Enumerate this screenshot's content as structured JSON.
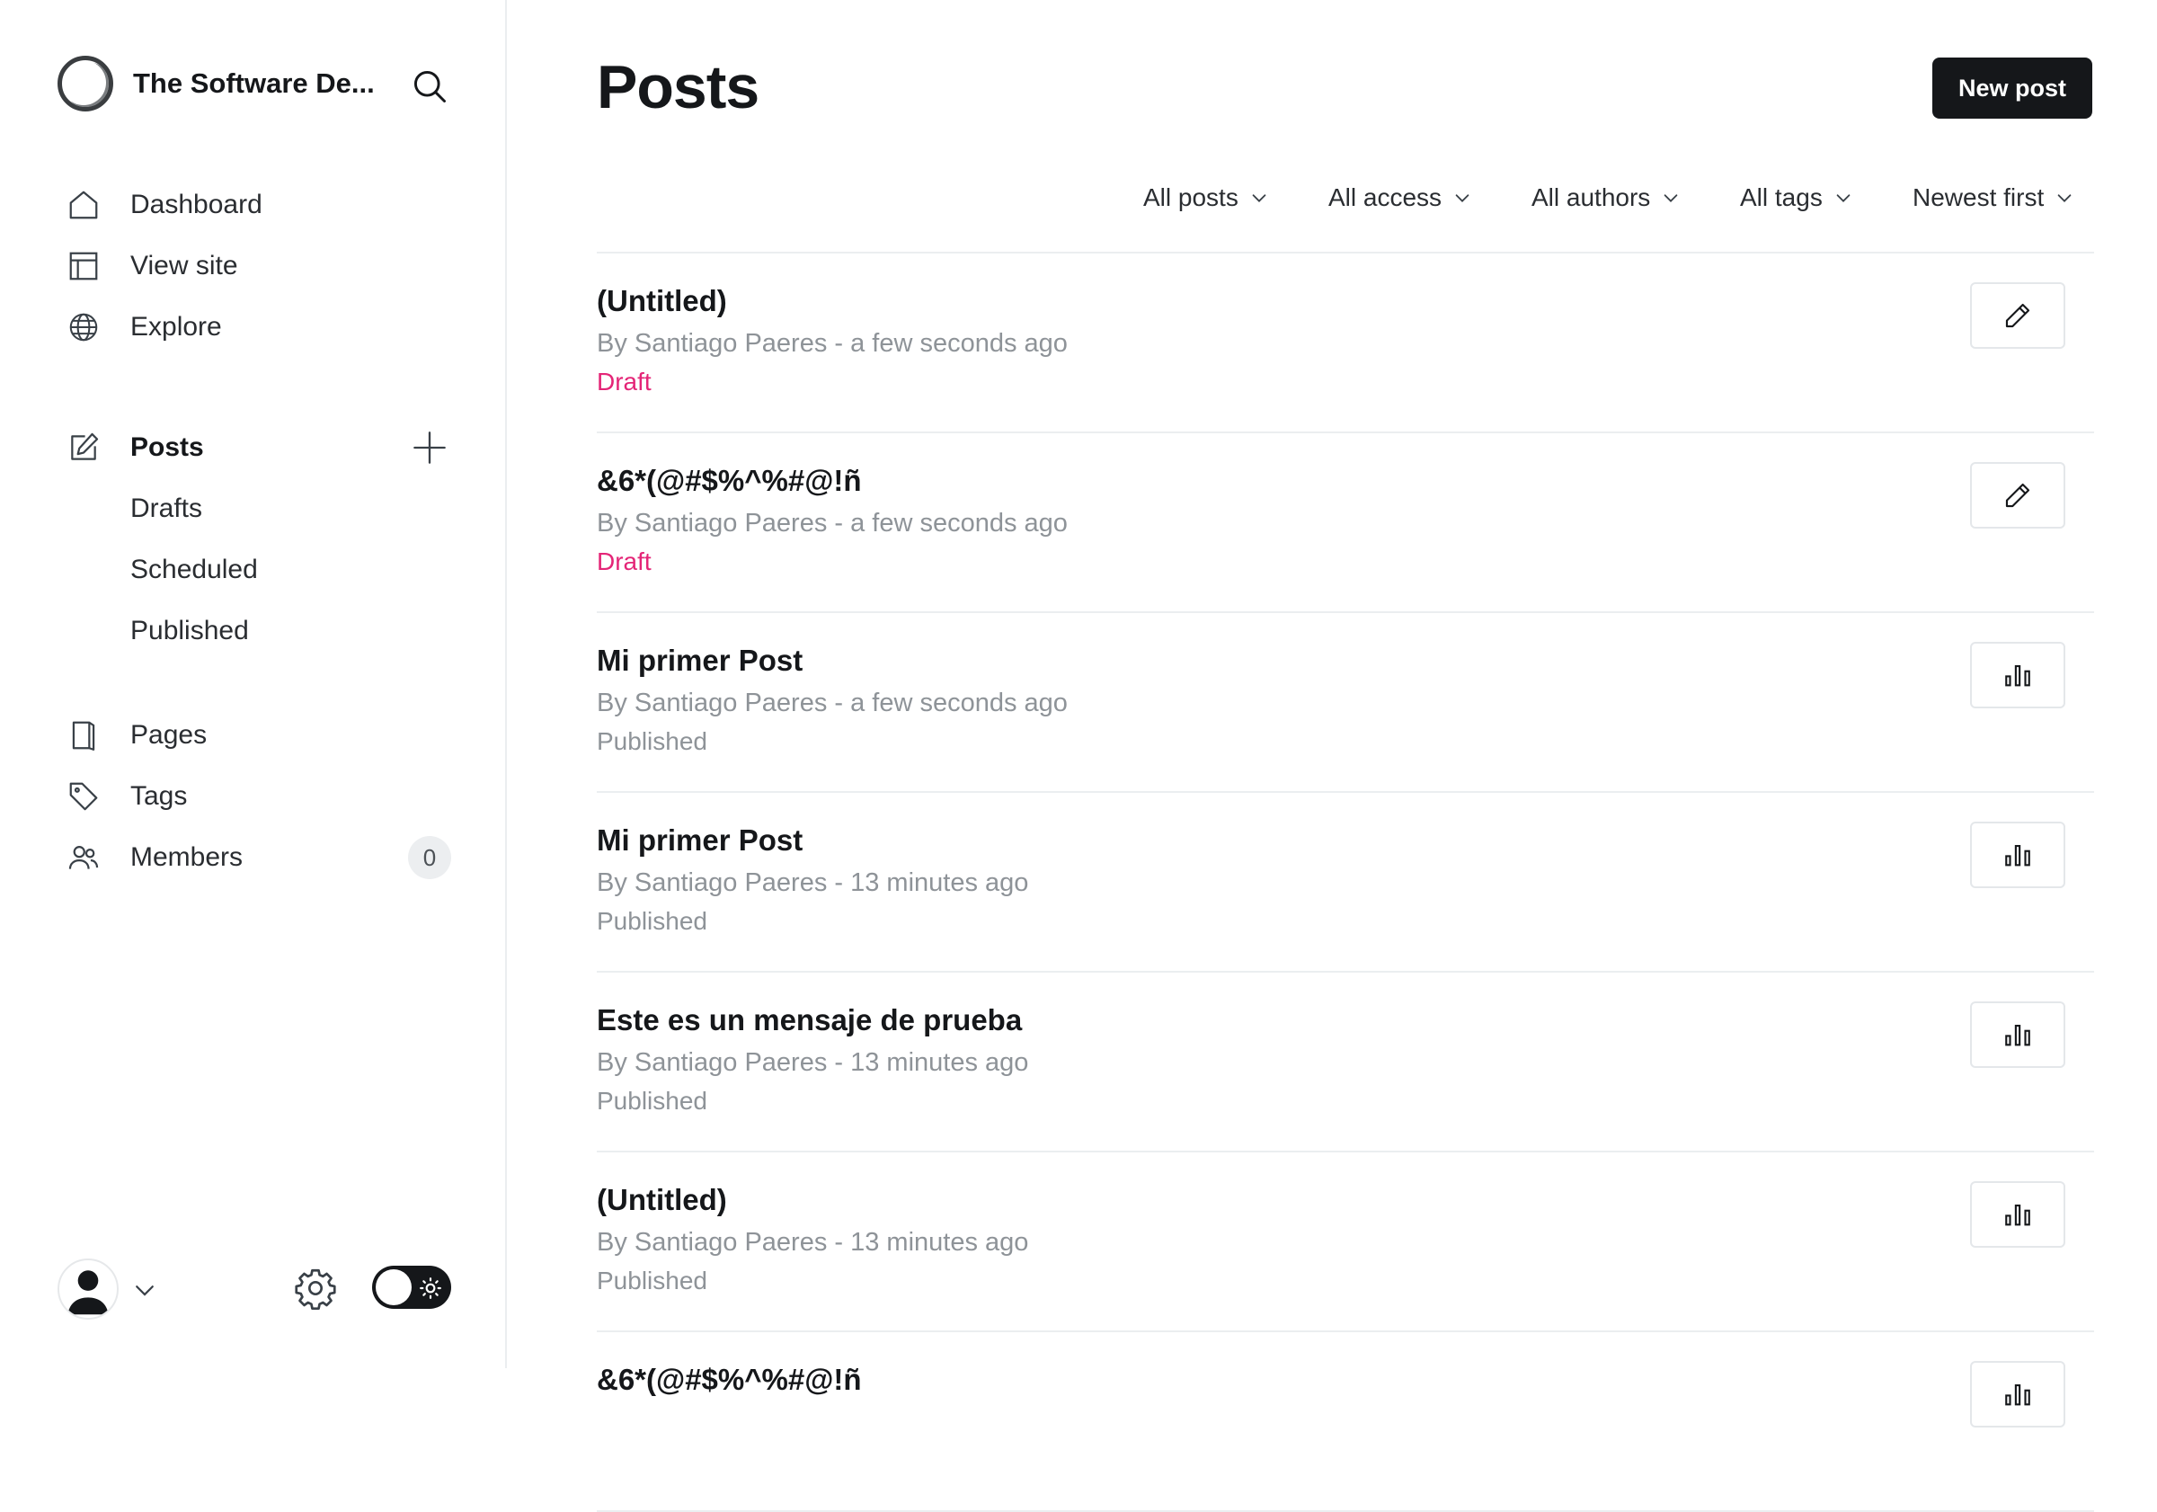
{
  "sidebar": {
    "site_name": "The Software De...",
    "nav": [
      {
        "label": "Dashboard",
        "icon": "home-icon"
      },
      {
        "label": "View site",
        "icon": "layout-icon"
      },
      {
        "label": "Explore",
        "icon": "globe-icon"
      }
    ],
    "posts_section": {
      "label": "Posts",
      "icon": "edit-icon",
      "sub_items": [
        "Drafts",
        "Scheduled",
        "Published"
      ]
    },
    "more_nav": [
      {
        "label": "Pages",
        "icon": "page-icon"
      },
      {
        "label": "Tags",
        "icon": "tag-icon"
      },
      {
        "label": "Members",
        "icon": "members-icon",
        "count": "0"
      }
    ]
  },
  "header": {
    "title": "Posts",
    "new_post_label": "New post"
  },
  "filters": [
    "All posts",
    "All access",
    "All authors",
    "All tags",
    "Newest first"
  ],
  "posts": [
    {
      "title": "(Untitled)",
      "meta": "By Santiago Paeres - a few seconds ago",
      "status": "Draft",
      "action": "edit-icon"
    },
    {
      "title": "&6*(@#$%^%#@!ñ",
      "meta": "By Santiago Paeres - a few seconds ago",
      "status": "Draft",
      "action": "edit-icon"
    },
    {
      "title": "Mi primer Post",
      "meta": "By Santiago Paeres - a few seconds ago",
      "status": "Published",
      "action": "analytics-icon"
    },
    {
      "title": "Mi primer Post",
      "meta": "By Santiago Paeres - 13 minutes ago",
      "status": "Published",
      "action": "analytics-icon"
    },
    {
      "title": "Este es un mensaje de prueba",
      "meta": "By Santiago Paeres - 13 minutes ago",
      "status": "Published",
      "action": "analytics-icon"
    },
    {
      "title": "(Untitled)",
      "meta": "By Santiago Paeres - 13 minutes ago",
      "status": "Published",
      "action": "analytics-icon"
    },
    {
      "title": "&6*(@#$%^%#@!ñ",
      "meta": "",
      "status": "",
      "action": "analytics-icon"
    }
  ],
  "colors": {
    "accent_dark": "#15171a",
    "draft": "#e42577",
    "muted_text": "#8e9398",
    "divider": "#ebeef0"
  }
}
